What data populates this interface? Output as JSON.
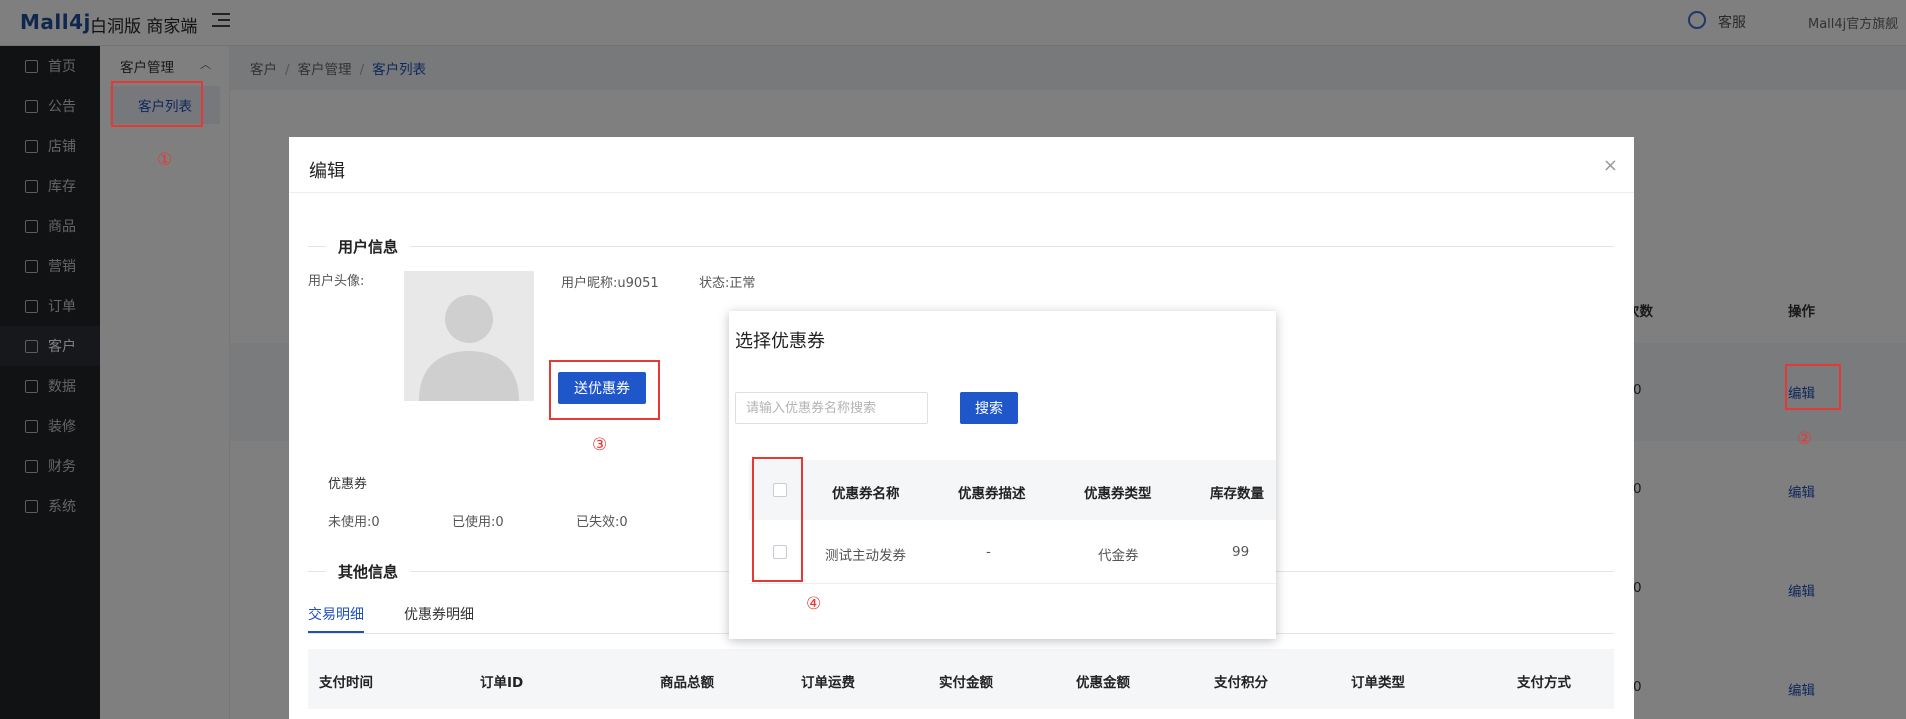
{
  "header": {
    "logo": "Mall4j",
    "edition": "白洞版 商家端",
    "service_label": "客服",
    "shop_name": "Mall4j官方旗舰"
  },
  "sidebar": {
    "items": [
      {
        "label": "首页",
        "icon": "home-icon"
      },
      {
        "label": "公告",
        "icon": "notice-icon"
      },
      {
        "label": "店铺",
        "icon": "shop-icon"
      },
      {
        "label": "库存",
        "icon": "stock-icon"
      },
      {
        "label": "商品",
        "icon": "product-icon"
      },
      {
        "label": "营销",
        "icon": "gift-icon"
      },
      {
        "label": "订单",
        "icon": "order-icon"
      },
      {
        "label": "客户",
        "icon": "customer-icon"
      },
      {
        "label": "数据",
        "icon": "data-icon"
      },
      {
        "label": "装修",
        "icon": "decorate-icon"
      },
      {
        "label": "财务",
        "icon": "finance-icon"
      },
      {
        "label": "系统",
        "icon": "settings-icon"
      }
    ],
    "active_index": 7
  },
  "submenu": {
    "title": "客户管理",
    "item": "客户列表"
  },
  "breadcrumb": [
    "客户",
    "客户管理",
    "客户列表"
  ],
  "background_table": {
    "col_count_header": "次数",
    "col_action_header": "操作",
    "rows": [
      {
        "count": "0",
        "action": "编辑"
      },
      {
        "count": "0",
        "action": "编辑"
      },
      {
        "count": "0",
        "action": "编辑"
      },
      {
        "count": "0",
        "action": "编辑"
      }
    ]
  },
  "dialog": {
    "title": "编辑",
    "close": "×",
    "user_section": "用户信息",
    "avatar_label": "用户头像:",
    "nickname": "用户昵称:u9051",
    "status": "状态:正常",
    "send_coupon_button": "送优惠券",
    "coupon_section": "优惠券",
    "unused": "未使用:0",
    "used": "已使用:0",
    "expired": "已失效:0",
    "other_section": "其他信息",
    "tabs": [
      "交易明细",
      "优惠券明细"
    ],
    "active_tab": 0,
    "trade_columns": [
      "支付时间",
      "订单ID",
      "商品总额",
      "订单运费",
      "实付金额",
      "优惠金额",
      "支付积分",
      "订单类型",
      "支付方式"
    ]
  },
  "coupon_popup": {
    "title": "选择优惠券",
    "search_placeholder": "请输入优惠券名称搜索",
    "search_button": "搜索",
    "columns": [
      "优惠券名称",
      "优惠券描述",
      "优惠券类型",
      "库存数量"
    ],
    "rows": [
      {
        "name": "测试主动发券",
        "desc": "-",
        "type": "代金券",
        "stock": "99"
      }
    ]
  },
  "annotations": {
    "marker_1": "①",
    "marker_2": "②",
    "marker_3": "③",
    "marker_4": "④",
    "color": "#e53935"
  }
}
